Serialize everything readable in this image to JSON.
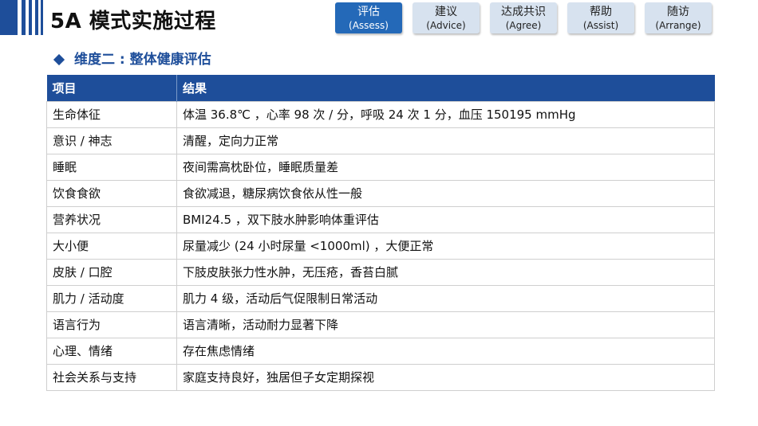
{
  "header": {
    "title": "5A 模式实施过程",
    "nav": [
      {
        "zh": "评估",
        "en": "(Assess)",
        "active": true
      },
      {
        "zh": "建议",
        "en": "(Advice)",
        "active": false
      },
      {
        "zh": "达成共识",
        "en": "(Agree)",
        "active": false
      },
      {
        "zh": "帮助",
        "en": "(Assist)",
        "active": false
      },
      {
        "zh": "随访",
        "en": "(Arrange)",
        "active": false
      }
    ]
  },
  "section": {
    "dimension_label": "维度二 : 整体健康评估"
  },
  "table": {
    "headers": [
      "项目",
      "结果"
    ],
    "rows": [
      [
        "生命体征",
        "体温 36.8℃ ，心率 98 次 / 分，呼吸 24 次 1 分，血压 150195 mmHg"
      ],
      [
        "意识 / 神志",
        "清醒，定向力正常"
      ],
      [
        "睡眠",
        "夜间需高枕卧位，睡眠质量差"
      ],
      [
        "饮食食欲",
        "食欲减退，糖尿病饮食依从性一般"
      ],
      [
        "营养状况",
        "BMI24.5 ，双下肢水肿影响体重评估"
      ],
      [
        "大小便",
        "尿量减少 (24 小时尿量 <1000ml) ，大便正常"
      ],
      [
        "皮肤 / 口腔",
        "下肢皮肤张力性水肿，无压疮，香苔白腻"
      ],
      [
        "肌力 / 活动度",
        "肌力 4 级，活动后气促限制日常活动"
      ],
      [
        "语言行为",
        "语言清晰，活动耐力显著下降"
      ],
      [
        "心理、情绪",
        "存在焦虑情绪"
      ],
      [
        "社会关系与支持",
        "家庭支持良好，独居但子女定期探视"
      ]
    ]
  },
  "colors": {
    "brand_blue": "#1e4e9a",
    "active_tab": "#2469b8",
    "inactive_tab": "#d7e2ef"
  }
}
